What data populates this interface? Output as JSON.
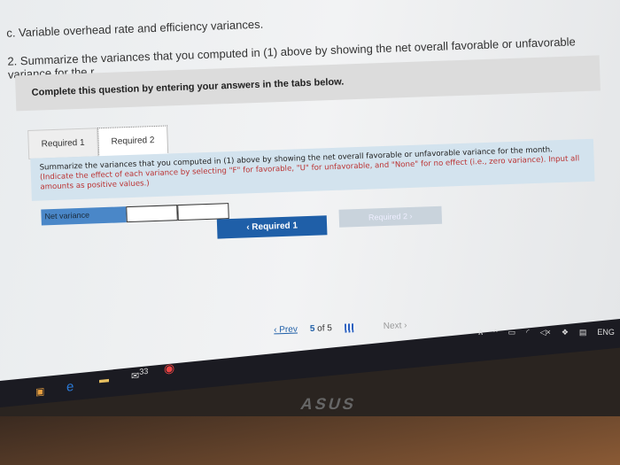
{
  "question": {
    "part_c": "c. Variable overhead rate and efficiency variances.",
    "part_2": "2. Summarize the variances that you computed in (1) above by showing the net overall favorable or unfavorable variance for the r"
  },
  "banner": "Complete this question by entering your answers in the tabs below.",
  "tabs": [
    {
      "label": "Required 1"
    },
    {
      "label": "Required 2",
      "active": true
    }
  ],
  "instructions": {
    "main": "Summarize the variances that you computed in (1) above by showing the net overall favorable or unfavorable variance for the month.",
    "red": "(Indicate the effect of each variance by selecting \"F\" for favorable, \"U\" for unfavorable, and \"None\" for no effect (i.e., zero variance). Input all amounts as positive values.)"
  },
  "row": {
    "label": "Net variance",
    "amount": "",
    "effect": ""
  },
  "buttons": {
    "prev_req": "Required 1",
    "next_req": "Required 2"
  },
  "pager": {
    "prev": "Prev",
    "current": "5",
    "of": "of",
    "total": "5",
    "next": "Next"
  },
  "taskbar": {
    "mail_badge": "33",
    "lang": "ENG",
    "brand": "ASUS"
  },
  "colors": {
    "accent": "#1f5fa8",
    "instructions_bg": "#d3e3ee",
    "label_bg": "#4a87c8"
  }
}
